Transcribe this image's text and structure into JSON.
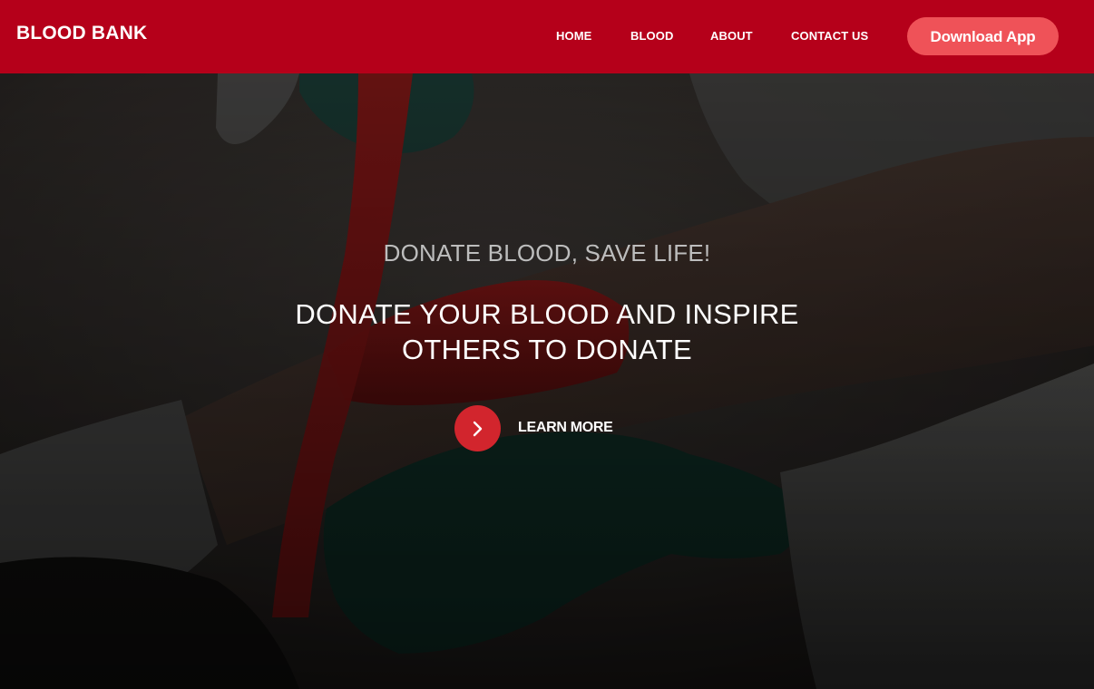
{
  "header": {
    "brand": "BLOOD BANK",
    "nav": {
      "home": "HOME",
      "blood": "BLOOD",
      "about": "ABOUT",
      "contact": "CONTACT US"
    },
    "download_label": "Download App"
  },
  "hero": {
    "subtitle": "DONATE BLOOD, SAVE LIFE!",
    "headline": "DONATE YOUR BLOOD AND INSPIRE OTHERS TO DONATE",
    "cta_label": "LEARN MORE",
    "cta_icon": "chevron-right-icon"
  },
  "colors": {
    "brand_red": "#b5001a",
    "download_button": "#ef5258",
    "cta_circle": "#d2252d"
  }
}
